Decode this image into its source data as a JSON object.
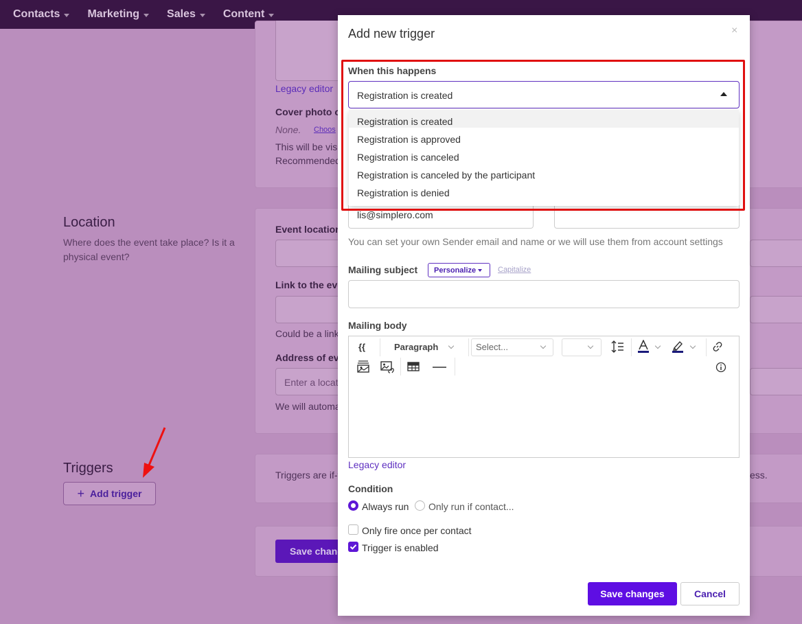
{
  "topnav": {
    "items": [
      {
        "label": "Contacts"
      },
      {
        "label": "Marketing"
      },
      {
        "label": "Sales"
      },
      {
        "label": "Content"
      }
    ]
  },
  "background": {
    "legacy_editor_link": "Legacy editor",
    "cover_photo_label": "Cover photo o",
    "cover_none": "None.",
    "cover_choose": "Choos",
    "cover_help_1": "This will be visi",
    "cover_help_2": "Recommended",
    "location": {
      "title": "Location",
      "description": "Where does the event take place? Is it a physical event?",
      "event_location_label": "Event location",
      "link_label": "Link to the eve",
      "link_help": "Could be a link",
      "address_label": "Address of eve",
      "address_placeholder": "Enter a locati",
      "address_help": "We will automa"
    },
    "triggers": {
      "title": "Triggers",
      "add_button": "Add trigger",
      "description_start": "Triggers are if-t",
      "description_end": "ess."
    },
    "save_button": "Save chang"
  },
  "modal": {
    "title": "Add new trigger",
    "close_glyph": "×",
    "when_label": "When this happens",
    "selected": "Registration is created",
    "options": [
      "Registration is created",
      "Registration is approved",
      "Registration is canceled",
      "Registration is canceled by the participant",
      "Registration is denied"
    ],
    "sender_email_value": "lis@simplero.com",
    "sender_help": "You can set your own Sender email and name or we will use them from account settings",
    "subject_label": "Mailing subject",
    "personalize_label": "Personalize",
    "capitalize_label": "Capitalize",
    "body_label": "Mailing body",
    "toolbar": {
      "paragraph": "Paragraph",
      "font_select": "Select..."
    },
    "legacy_editor": "Legacy editor",
    "condition_label": "Condition",
    "always_run": "Always run",
    "only_if": "Only run if contact...",
    "fire_once": "Only fire once per contact",
    "enabled": "Trigger is enabled",
    "save_button": "Save changes",
    "cancel_button": "Cancel"
  },
  "colors": {
    "accent": "#5e0ee3",
    "highlight": "#e01010",
    "nav_bg": "#3a1646"
  }
}
